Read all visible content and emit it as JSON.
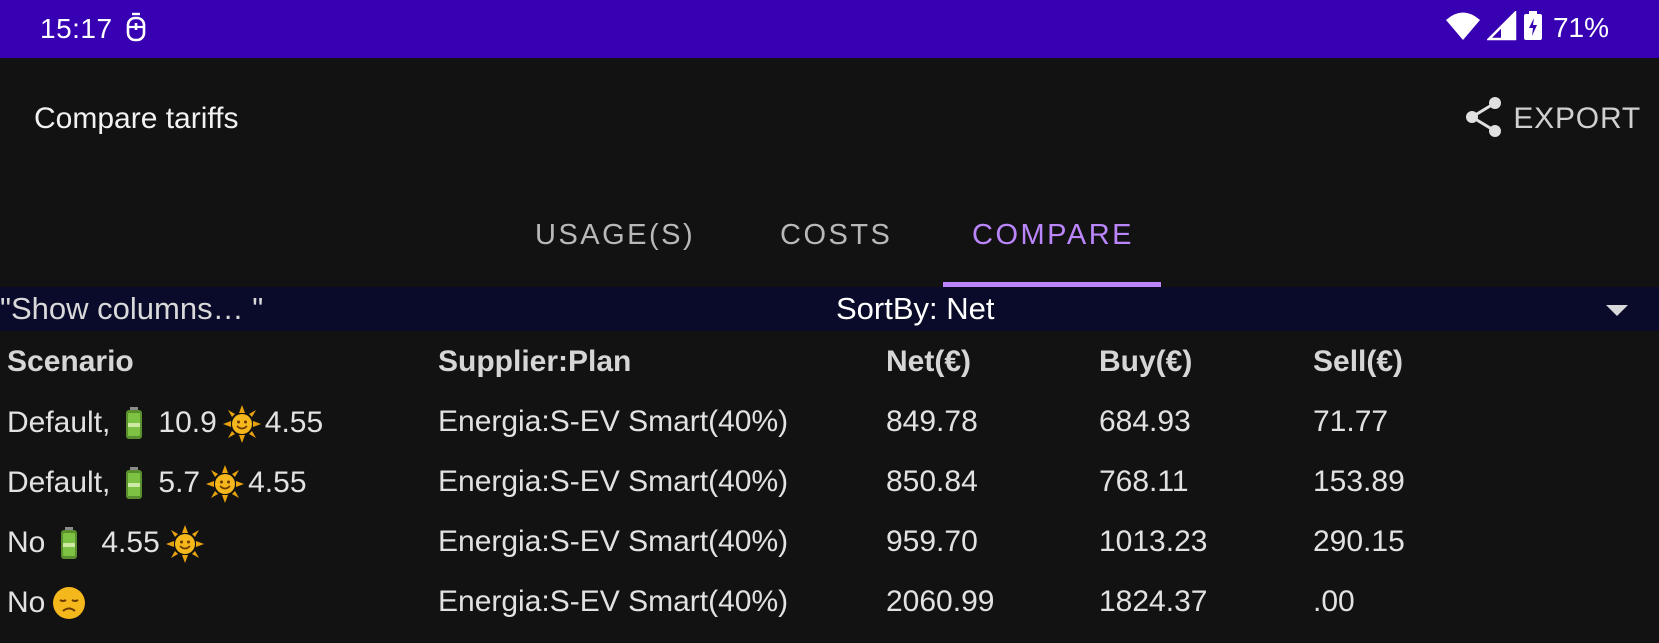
{
  "status_bar": {
    "time": "15:17",
    "battery_percent": "71%",
    "notification_icon": "accessibility-icon",
    "icons": [
      "wifi-icon",
      "signal-icon",
      "battery-charging-icon"
    ]
  },
  "app_bar": {
    "title": "Compare tariffs",
    "export_label": "EXPORT",
    "export_icon": "share-icon"
  },
  "tabs": [
    {
      "label": "USAGE(S)",
      "active": false
    },
    {
      "label": "COSTS",
      "active": false
    },
    {
      "label": "COMPARE",
      "active": true
    }
  ],
  "filter_bar": {
    "show_columns": "\"Show columns… \"",
    "sort_by": "SortBy: Net"
  },
  "table": {
    "headers": [
      "Scenario",
      "Supplier:Plan",
      "Net(€)",
      "Buy(€)",
      "Sell(€)"
    ],
    "rows": [
      {
        "scenario_prefix": "Default,",
        "battery_value": "10.9",
        "solar_value": "4.55",
        "plan": "Energia:S-EV Smart(40%)",
        "net": "849.78",
        "buy": "684.93",
        "sell": "71.77"
      },
      {
        "scenario_prefix": "Default,",
        "battery_value": "5.7",
        "solar_value": "4.55",
        "plan": "Energia:S-EV Smart(40%)",
        "net": "850.84",
        "buy": "768.11",
        "sell": "153.89"
      },
      {
        "scenario_prefix": "No",
        "solar_value": "4.55",
        "plan": "Energia:S-EV Smart(40%)",
        "net": "959.70",
        "buy": "1013.23",
        "sell": "290.15"
      },
      {
        "scenario_prefix": "No",
        "plan": "Energia:S-EV Smart(40%)",
        "net": "2060.99",
        "buy": "1824.37",
        "sell": ".00"
      }
    ]
  },
  "colors": {
    "status_bar": "#3700b3",
    "background": "#121212",
    "accent": "#bb86fc",
    "filter_bar": "#0a0a2a"
  }
}
